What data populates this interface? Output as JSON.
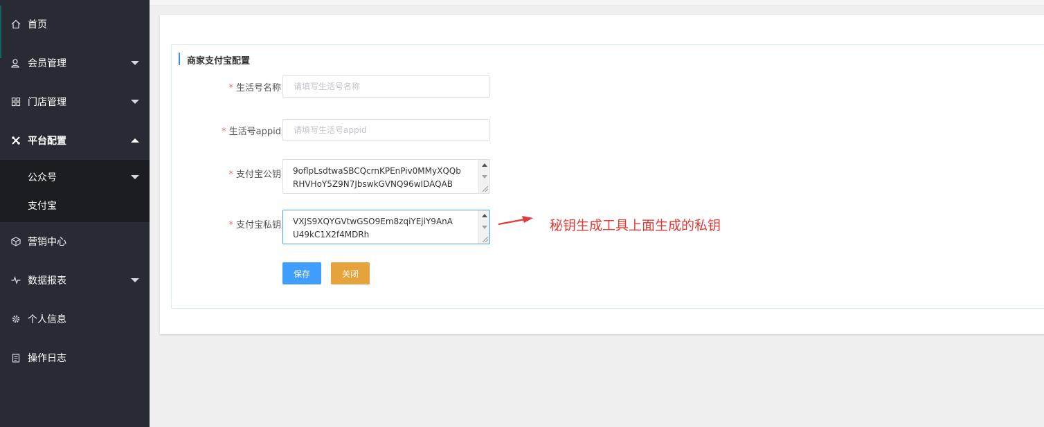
{
  "sidebar": {
    "items": [
      {
        "label": "首页",
        "icon": "home-icon"
      },
      {
        "label": "会员管理",
        "icon": "user-icon"
      },
      {
        "label": "门店管理",
        "icon": "store-icon"
      },
      {
        "label": "平台配置",
        "icon": "tools-icon"
      },
      {
        "label": "营销中心",
        "icon": "cube-icon"
      },
      {
        "label": "数据报表",
        "icon": "pulse-icon"
      },
      {
        "label": "个人信息",
        "icon": "gear-icon"
      },
      {
        "label": "操作日志",
        "icon": "clipboard-icon"
      }
    ],
    "submenu": [
      {
        "label": "公众号"
      },
      {
        "label": "支付宝"
      }
    ]
  },
  "form": {
    "legend": "商家支付宝配置",
    "fields": [
      {
        "label": "生活号名称",
        "placeholder": "请填写生活号名称",
        "value": ""
      },
      {
        "label": "生活号appid",
        "placeholder": "请填写生活号appid",
        "value": ""
      },
      {
        "label": "支付宝公钥",
        "lines": [
          "9oflpLsdtwaSBCQcrnKPEnPiv0MMyXQQb",
          "RHVHoY5Z9N7JbswkGVNQ96wIDAQAB"
        ]
      },
      {
        "label": "支付宝私钥",
        "lines": [
          "VXJS9XQYGVtwGSO9Em8zqiYEjiY9AnA",
          "U49kC1X2f4MDRh"
        ]
      }
    ],
    "required_mark": "*",
    "save_label": "保存",
    "close_label": "关闭"
  },
  "annotation": {
    "text": "秘钥生成工具上面生成的私钥",
    "color": "#e53935"
  },
  "colors": {
    "sidebar_bg": "#282b33",
    "primary": "#409eff",
    "warning": "#e6a23c"
  }
}
